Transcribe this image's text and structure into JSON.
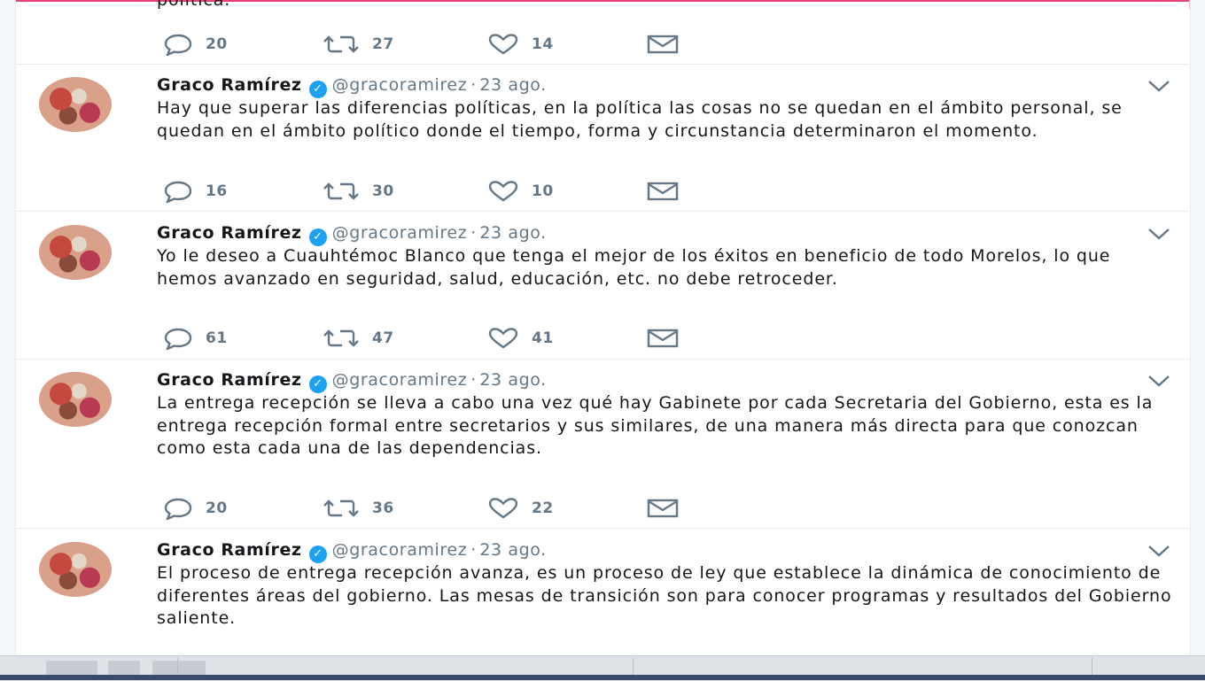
{
  "partial_tweet": {
    "text_fragment": "política.",
    "replies": "20",
    "retweets": "27",
    "likes": "14"
  },
  "tweets": [
    {
      "name": "Graco Ramírez",
      "handle": "@gracoramirez",
      "date": "23 ago.",
      "text": "Hay que superar las diferencias políticas, en la política las cosas no se quedan en el ámbito personal, se quedan en el ámbito político donde el tiempo, forma y circunstancia determinaron el momento.",
      "replies": "16",
      "retweets": "30",
      "likes": "10"
    },
    {
      "name": "Graco Ramírez",
      "handle": "@gracoramirez",
      "date": "23 ago.",
      "text": "Yo le deseo a Cuauhtémoc Blanco que tenga el mejor de los éxitos en beneficio de todo Morelos, lo que hemos avanzado en seguridad, salud, educación, etc. no debe retroceder.",
      "replies": "61",
      "retweets": "47",
      "likes": "41"
    },
    {
      "name": "Graco Ramírez",
      "handle": "@gracoramirez",
      "date": "23 ago.",
      "text": "La entrega recepción se lleva a cabo una vez qué hay Gabinete por cada Secretaria del Gobierno, esta es la entrega recepción formal entre secretarios y sus similares, de una manera más directa para que conozcan como esta cada una de las dependencias.",
      "replies": "20",
      "retweets": "36",
      "likes": "22"
    },
    {
      "name": "Graco Ramírez",
      "handle": "@gracoramirez",
      "date": "23 ago.",
      "text": "El proceso de entrega recepción avanza, es un proceso de ley que establece la dinámica de conocimiento de diferentes áreas del gobierno. Las mesas de transición son para conocer programas y resultados del Gobierno saliente."
    }
  ],
  "icons": {
    "reply": "reply-icon",
    "retweet": "retweet-icon",
    "like": "heart-icon",
    "dm": "envelope-icon",
    "verified": "verified-badge-icon",
    "caret": "chevron-down-icon"
  },
  "colors": {
    "text": "#14171a",
    "secondary": "#657786",
    "verified": "#1da1f2",
    "accent_border": "#e8417a",
    "taskbar": "#dfe3e8"
  }
}
